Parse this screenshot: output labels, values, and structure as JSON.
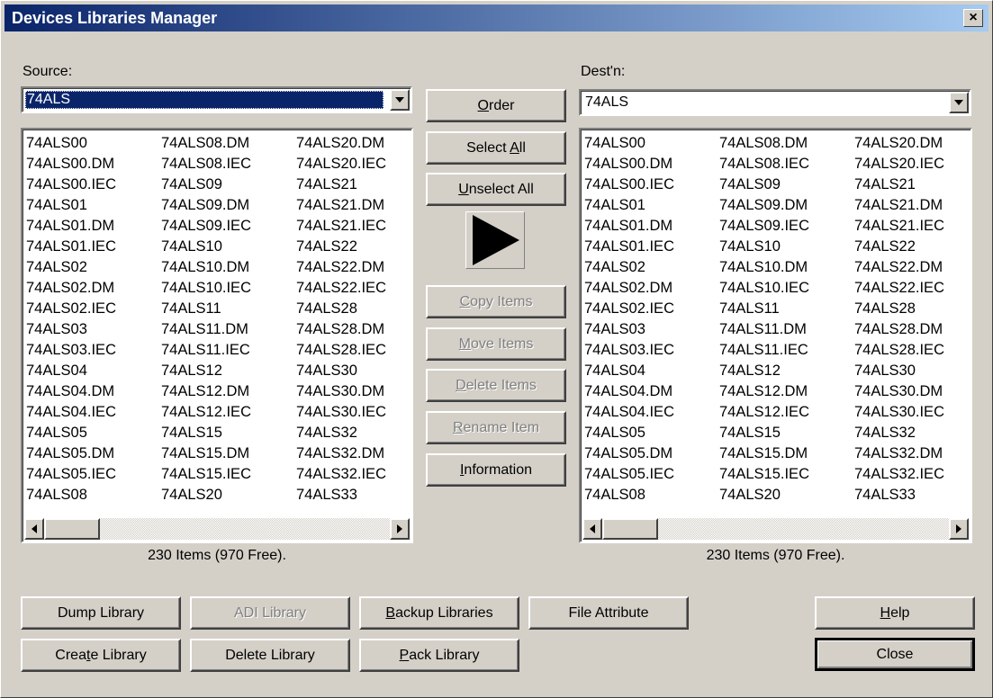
{
  "window": {
    "title": "Devices Libraries Manager",
    "close_glyph": "×"
  },
  "source": {
    "label": "Source:",
    "selected": "74ALS",
    "columns": [
      [
        "74ALS00",
        "74ALS00.DM",
        "74ALS00.IEC",
        "74ALS01",
        "74ALS01.DM",
        "74ALS01.IEC",
        "74ALS02",
        "74ALS02.DM",
        "74ALS02.IEC",
        "74ALS03",
        "74ALS03.IEC",
        "74ALS04",
        "74ALS04.DM",
        "74ALS04.IEC",
        "74ALS05",
        "74ALS05.DM",
        "74ALS05.IEC",
        "74ALS08"
      ],
      [
        "74ALS08.DM",
        "74ALS08.IEC",
        "74ALS09",
        "74ALS09.DM",
        "74ALS09.IEC",
        "74ALS10",
        "74ALS10.DM",
        "74ALS10.IEC",
        "74ALS11",
        "74ALS11.DM",
        "74ALS11.IEC",
        "74ALS12",
        "74ALS12.DM",
        "74ALS12.IEC",
        "74ALS15",
        "74ALS15.DM",
        "74ALS15.IEC",
        "74ALS20"
      ],
      [
        "74ALS20.DM",
        "74ALS20.IEC",
        "74ALS21",
        "74ALS21.DM",
        "74ALS21.IEC",
        "74ALS22",
        "74ALS22.DM",
        "74ALS22.IEC",
        "74ALS28",
        "74ALS28.DM",
        "74ALS28.IEC",
        "74ALS30",
        "74ALS30.DM",
        "74ALS30.IEC",
        "74ALS32",
        "74ALS32.DM",
        "74ALS32.IEC",
        "74ALS33"
      ]
    ],
    "status": "230 Items (970 Free)."
  },
  "dest": {
    "label": "Dest'n:",
    "selected": "74ALS",
    "columns": [
      [
        "74ALS00",
        "74ALS00.DM",
        "74ALS00.IEC",
        "74ALS01",
        "74ALS01.DM",
        "74ALS01.IEC",
        "74ALS02",
        "74ALS02.DM",
        "74ALS02.IEC",
        "74ALS03",
        "74ALS03.IEC",
        "74ALS04",
        "74ALS04.DM",
        "74ALS04.IEC",
        "74ALS05",
        "74ALS05.DM",
        "74ALS05.IEC",
        "74ALS08"
      ],
      [
        "74ALS08.DM",
        "74ALS08.IEC",
        "74ALS09",
        "74ALS09.DM",
        "74ALS09.IEC",
        "74ALS10",
        "74ALS10.DM",
        "74ALS10.IEC",
        "74ALS11",
        "74ALS11.DM",
        "74ALS11.IEC",
        "74ALS12",
        "74ALS12.DM",
        "74ALS12.IEC",
        "74ALS15",
        "74ALS15.DM",
        "74ALS15.IEC",
        "74ALS20"
      ],
      [
        "74ALS20.DM",
        "74ALS20.IEC",
        "74ALS21",
        "74ALS21.DM",
        "74ALS21.IEC",
        "74ALS22",
        "74ALS22.DM",
        "74ALS22.IEC",
        "74ALS28",
        "74ALS28.DM",
        "74ALS28.IEC",
        "74ALS30",
        "74ALS30.DM",
        "74ALS30.IEC",
        "74ALS32",
        "74ALS32.DM",
        "74ALS32.IEC",
        "74ALS33"
      ]
    ],
    "status": "230 Items (970 Free)."
  },
  "middle": {
    "order": {
      "mn": "O",
      "rest": "rder"
    },
    "select_all": {
      "pre": "Select ",
      "mn": "A",
      "rest": "ll"
    },
    "unselect_all": {
      "mn": "U",
      "rest": "nselect All"
    },
    "copy": {
      "mn": "C",
      "rest": "opy Items"
    },
    "move": {
      "mn": "M",
      "rest": "ove Items"
    },
    "delete": {
      "mn": "D",
      "rest": "elete Items"
    },
    "rename": {
      "mn": "R",
      "rest": "ename Item"
    },
    "information": {
      "mn": "I",
      "rest": "nformation"
    }
  },
  "bottom": {
    "dump": "Dump Library",
    "adi": "ADI Library",
    "backup": {
      "mn": "B",
      "rest": "ackup Libraries"
    },
    "file_attr": "File Attribute",
    "help": {
      "mn": "H",
      "rest": "elp"
    },
    "create": {
      "pre": "Crea",
      "mn": "t",
      "rest": "e Library"
    },
    "delete_lib": "Delete Library",
    "pack": {
      "mn": "P",
      "rest": "ack Library"
    },
    "close": "Close"
  },
  "icons": {
    "transfer": "right-arrow-icon",
    "dropdown": "down-triangle-icon"
  }
}
